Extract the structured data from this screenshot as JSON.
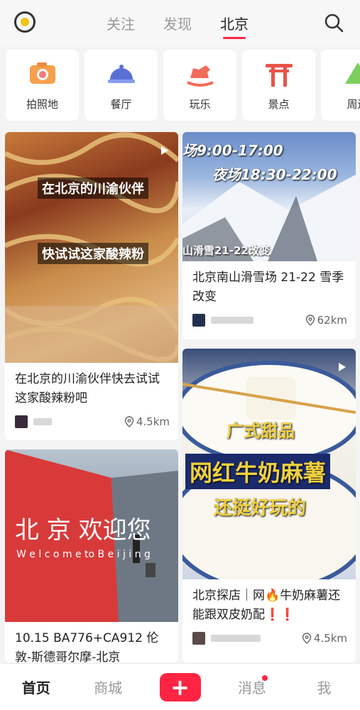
{
  "header": {
    "tabs": [
      {
        "label": "关注"
      },
      {
        "label": "发现"
      },
      {
        "label": "北京"
      }
    ],
    "active_tab": "北京",
    "accent_color": "#ff2442"
  },
  "categories": [
    {
      "label": "拍照地",
      "icon": "camera-icon"
    },
    {
      "label": "餐厅",
      "icon": "dish-cover-icon"
    },
    {
      "label": "玩乐",
      "icon": "rocking-horse-icon"
    },
    {
      "label": "景点",
      "icon": "torii-gate-icon"
    },
    {
      "label": "周边",
      "icon": "mountain-icon"
    }
  ],
  "feed": {
    "card1": {
      "overlay1": "在北京的川渝伙伴",
      "overlay2": "快试试这家酸辣粉",
      "title": "在北京的川渝伙伴快去试试这家酸辣粉吧",
      "distance": "4.5km"
    },
    "card2": {
      "overlay1": "场9:00-17:00",
      "overlay2": "夜场18:30-22:00",
      "overlay3": "山滑雪21-22改变",
      "title": "北京南山滑雪场 21-22 雪季改变",
      "distance": "62km"
    },
    "card3": {
      "sign": "北 京 欢迎您",
      "sign_en": "W e l c o m e  to  B e i j i n g",
      "title": "10.15 BA776+CA912 伦敦-斯德哥尔摩-北京"
    },
    "card4": {
      "overlay1": "广式甜品",
      "overlay2": "网红牛奶麻薯",
      "overlay3": "还挺好玩的",
      "title": "北京探店｜网🔥牛奶麻薯还能跟双皮奶配❗❗",
      "distance": "4.5km"
    }
  },
  "bottom_nav": {
    "items": [
      {
        "label": "首页"
      },
      {
        "label": "商城"
      },
      {
        "label": "+"
      },
      {
        "label": "消息"
      },
      {
        "label": "我"
      }
    ]
  }
}
